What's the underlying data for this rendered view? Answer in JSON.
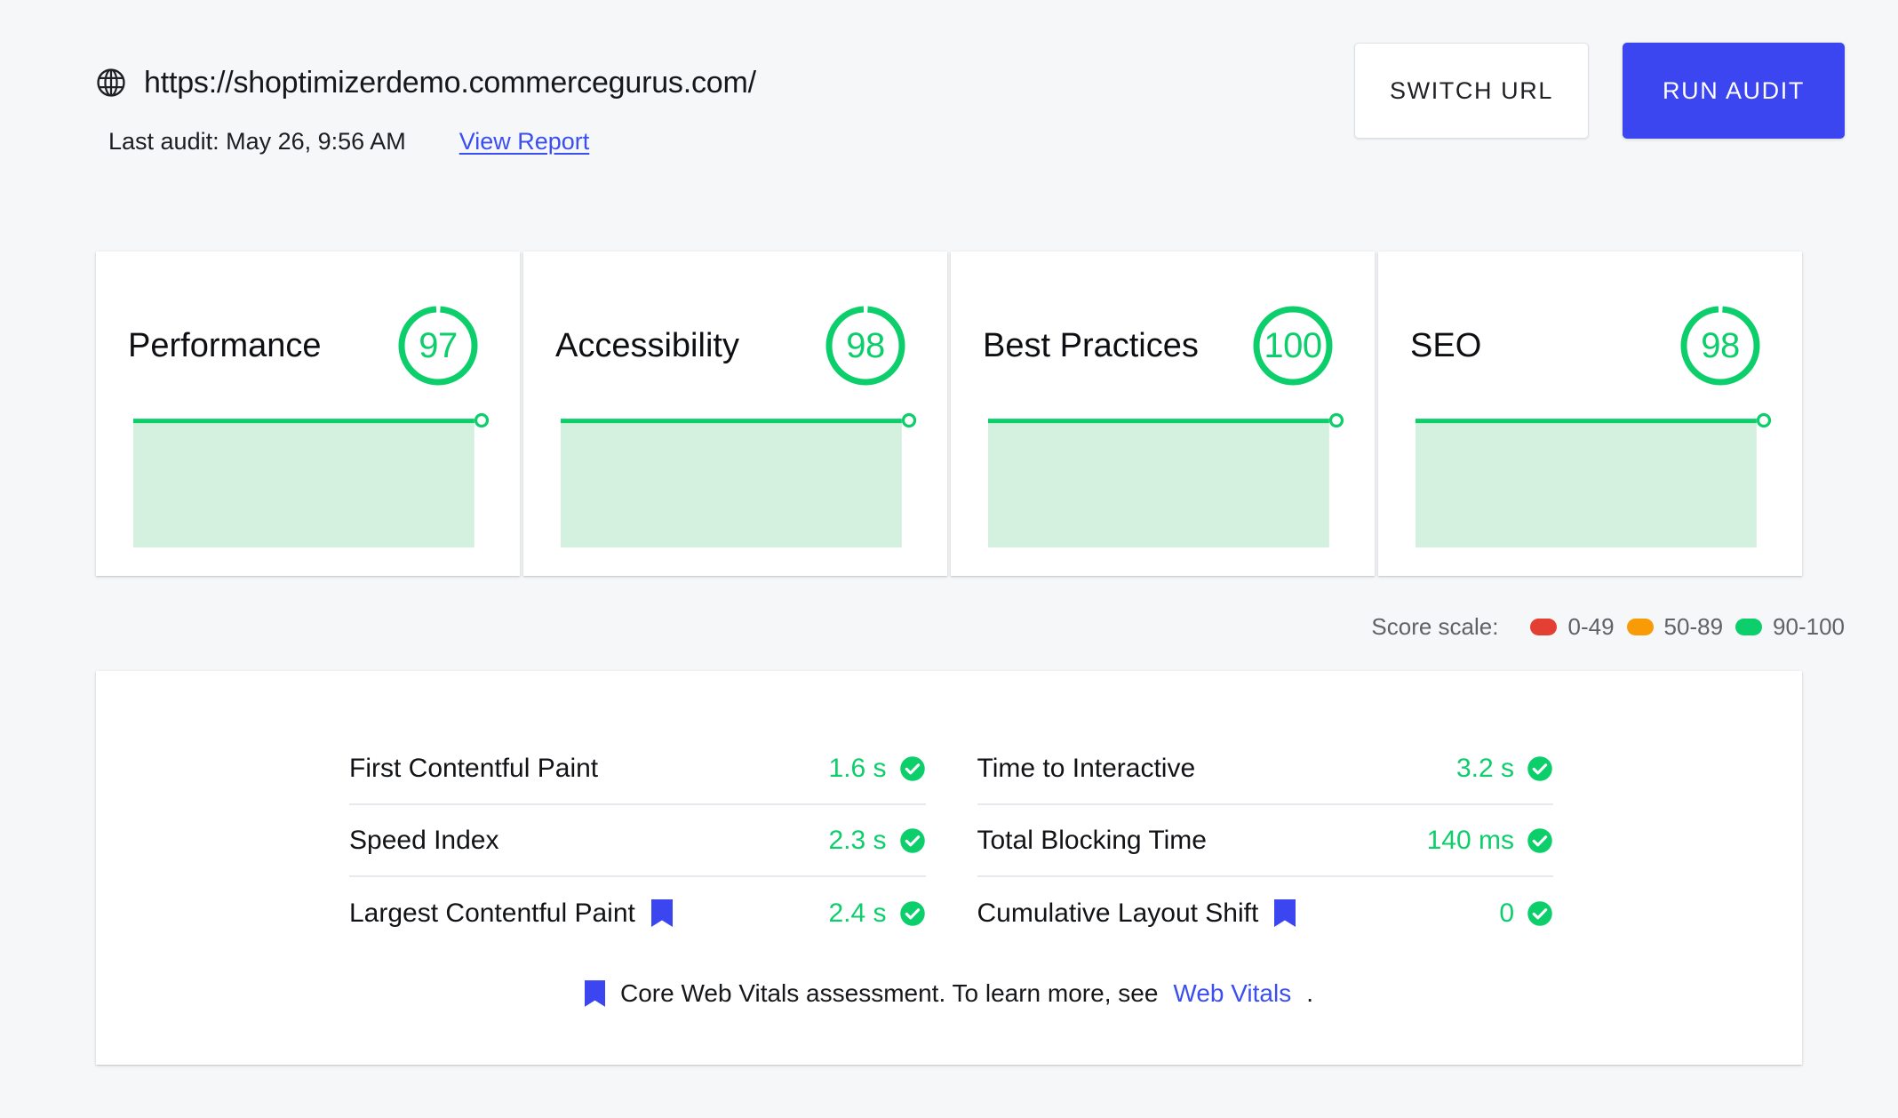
{
  "header": {
    "url": "https://shoptimizerdemo.commercegurus.com/",
    "globe_icon": "globe-icon",
    "last_audit": "Last audit: May 26, 9:56 AM",
    "view_report_label": "View Report",
    "switch_url_label": "SWITCH URL",
    "run_audit_label": "RUN AUDIT"
  },
  "scores": [
    {
      "label": "Performance",
      "value": "97",
      "pct": 97,
      "color": "#0cce6b"
    },
    {
      "label": "Accessibility",
      "value": "98",
      "pct": 98,
      "color": "#0cce6b"
    },
    {
      "label": "Best Practices",
      "value": "100",
      "pct": 100,
      "color": "#0cce6b"
    },
    {
      "label": "SEO",
      "value": "98",
      "pct": 98,
      "color": "#0cce6b"
    }
  ],
  "legend": {
    "label": "Score scale:",
    "items": [
      {
        "range": "0-49",
        "color": "#e33f33"
      },
      {
        "range": "50-89",
        "color": "#f99a07"
      },
      {
        "range": "90-100",
        "color": "#0cce6b"
      }
    ]
  },
  "metrics": {
    "left": [
      {
        "name": "First Contentful Paint",
        "value": "1.6 s",
        "status": "pass",
        "core_web_vital": false
      },
      {
        "name": "Speed Index",
        "value": "2.3 s",
        "status": "pass",
        "core_web_vital": false
      },
      {
        "name": "Largest Contentful Paint",
        "value": "2.4 s",
        "status": "pass",
        "core_web_vital": true
      }
    ],
    "right": [
      {
        "name": "Time to Interactive",
        "value": "3.2 s",
        "status": "pass",
        "core_web_vital": false
      },
      {
        "name": "Total Blocking Time",
        "value": "140 ms",
        "status": "pass",
        "core_web_vital": false
      },
      {
        "name": "Cumulative Layout Shift",
        "value": "0",
        "status": "pass",
        "core_web_vital": true
      }
    ]
  },
  "footnote": {
    "text_before": "Core Web Vitals assessment. To learn more, see",
    "link_label": "Web Vitals",
    "text_after": "."
  },
  "chart_data": {
    "type": "area",
    "title": "Lighthouse category score sparklines",
    "series": [
      {
        "name": "Performance",
        "values": [
          97,
          97,
          97,
          97,
          97
        ],
        "color": "#0cce6b",
        "fill": "#d4f0de"
      },
      {
        "name": "Accessibility",
        "values": [
          98,
          98,
          98,
          98,
          98
        ],
        "color": "#0cce6b",
        "fill": "#d4f0de"
      },
      {
        "name": "Best Practices",
        "values": [
          100,
          100,
          100,
          100,
          100
        ],
        "color": "#0cce6b",
        "fill": "#d4f0de"
      },
      {
        "name": "SEO",
        "values": [
          98,
          98,
          98,
          98,
          98
        ],
        "color": "#0cce6b",
        "fill": "#d4f0de"
      }
    ],
    "ylim": [
      0,
      100
    ],
    "grid": false,
    "legend_position": "none",
    "endpoint_marker": true
  }
}
